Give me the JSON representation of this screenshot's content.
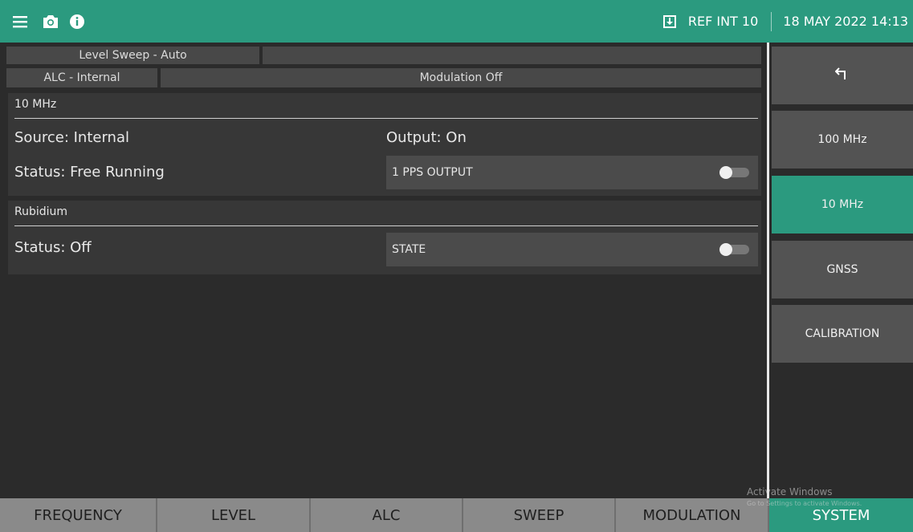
{
  "topbar": {
    "menu_icon": "hamburger-menu-icon",
    "camera_icon": "camera-icon",
    "info_icon": "info-icon",
    "ref_icon": "download-box-icon",
    "ref_label": "REF INT 10",
    "datetime": "18 MAY 2022 14:13",
    "accent": "#2b9a7f"
  },
  "status_headers": {
    "level_sweep": "Level Sweep - Auto",
    "alc": "ALC - Internal",
    "modulation": "Modulation Off"
  },
  "panel_10mhz": {
    "title": "10 MHz",
    "source": "Source: Internal",
    "output": "Output: On",
    "status": "Status: Free Running",
    "toggle_label": "1 PPS OUTPUT",
    "toggle_on": false
  },
  "panel_rubidium": {
    "title": "Rubidium",
    "status": "Status: Off",
    "toggle_label": "STATE",
    "toggle_on": false
  },
  "sidebar": {
    "back_icon": "return-arrow-icon",
    "items": [
      {
        "label": "100 MHz",
        "active": false
      },
      {
        "label": "10 MHz",
        "active": true
      },
      {
        "label": "GNSS",
        "active": false
      },
      {
        "label": "CALIBRATION",
        "active": false
      }
    ]
  },
  "bottom_tabs": [
    {
      "label": "FREQUENCY",
      "active": false
    },
    {
      "label": "LEVEL",
      "active": false
    },
    {
      "label": "ALC",
      "active": false
    },
    {
      "label": "SWEEP",
      "active": false
    },
    {
      "label": "MODULATION",
      "active": false
    },
    {
      "label": "SYSTEM",
      "active": true
    }
  ],
  "watermark": {
    "line1": "Activate Windows",
    "line2": "Go to Settings to activate Windows."
  }
}
